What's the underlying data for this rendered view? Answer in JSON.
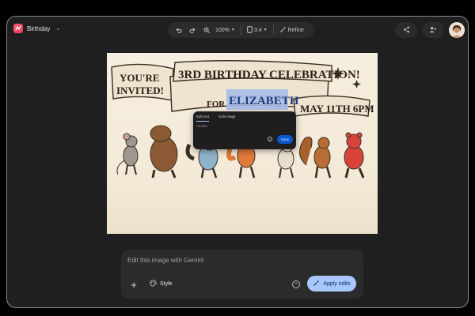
{
  "app": {
    "name": "Birthday",
    "logo_icon": "gemini-canvas-icon",
    "dropdown_icon": "chevron-down-icon"
  },
  "toolbar": {
    "undo_icon": "undo-icon",
    "redo_icon": "redo-icon",
    "zoom_icon": "zoom-in-icon",
    "zoom_value": "100%",
    "aspect_icon": "aspect-ratio-icon",
    "aspect_value": "3:4",
    "refine_label": "Refine"
  },
  "header_actions": {
    "share_icon": "share-icon",
    "add_person_icon": "person-add-icon",
    "avatar": "user-avatar"
  },
  "image": {
    "banner_left_1": "YOU'RE",
    "banner_left_2": "INVITED!",
    "banner_main": "3RD BIRTHDAY CELEBRATION!",
    "banner_for": "FOR",
    "banner_name": "ELIZABETH",
    "banner_date": "MAY 11TH 6PM"
  },
  "edit_popup": {
    "tabs": [
      {
        "label": "Edit text",
        "active": true
      },
      {
        "label": "Edit image",
        "active": false
      }
    ],
    "input_value": "Amelia",
    "clear_icon": "close-circle-icon",
    "save_label": "Save"
  },
  "prompt": {
    "placeholder": "Edit this image with Gemini",
    "add_icon": "plus-icon",
    "style_icon": "palette-icon",
    "style_label": "Style",
    "clear_icon": "close-circle-icon",
    "apply_icon": "sparkle-wand-icon",
    "apply_label": "Apply edits"
  },
  "colors": {
    "accent": "#a8c7fa",
    "save": "#0b57d0",
    "surface": "#2b2b2b",
    "background": "#1f1f1f",
    "app_logo": "#e8394e"
  }
}
